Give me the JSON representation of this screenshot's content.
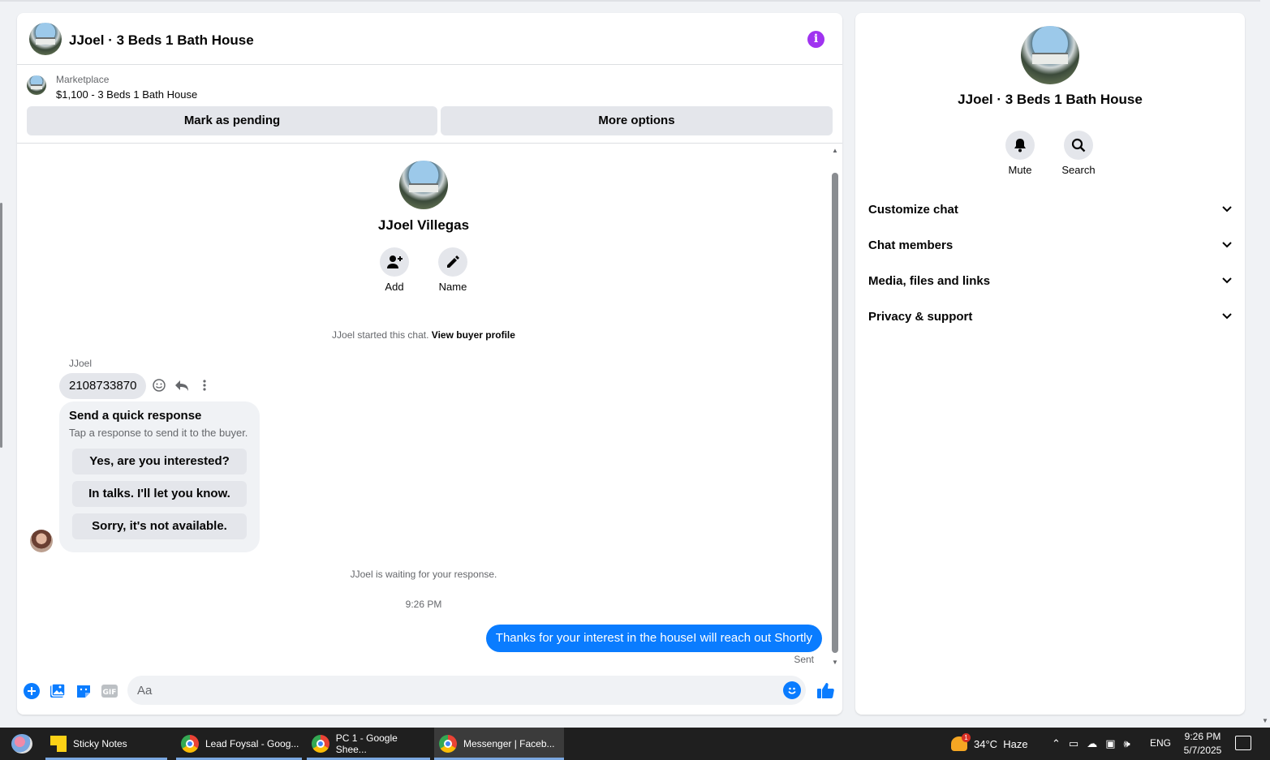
{
  "header": {
    "title": "JJoel · 3 Beds 1 Bath House"
  },
  "listing": {
    "label": "Marketplace",
    "price_title": "$1,100 - 3 Beds 1 Bath House",
    "pending_label": "Mark as pending",
    "more_label": "More options"
  },
  "profile": {
    "name": "JJoel Villegas",
    "add_label": "Add",
    "name_label": "Name"
  },
  "conversation": {
    "started_text": "JJoel started this chat. ",
    "view_profile_label": "View buyer profile",
    "sender_name": "JJoel",
    "incoming_message": "2108733870",
    "quick_response": {
      "title": "Send a quick response",
      "subtitle": "Tap a response to send it to the buyer.",
      "options": [
        "Yes, are you interested?",
        "In talks. I'll let you know.",
        "Sorry, it's not available."
      ]
    },
    "waiting_text": "JJoel is waiting for your response.",
    "timestamp": "9:26 PM",
    "outgoing_message": "Thanks for your interest in the houseI will reach out Shortly",
    "status": "Sent"
  },
  "composer": {
    "placeholder": "Aa"
  },
  "info_panel": {
    "title": "JJoel · 3 Beds 1 Bath House",
    "mute_label": "Mute",
    "search_label": "Search",
    "sections": [
      "Customize chat",
      "Chat members",
      "Media, files and links",
      "Privacy & support"
    ]
  },
  "taskbar": {
    "apps": [
      "Sticky Notes",
      "Lead Foysal - Goog...",
      "PC 1 - Google Shee...",
      "Messenger | Faceb..."
    ],
    "weather": "34°C  Haze",
    "weather_badge": "1",
    "language": "ENG",
    "time": "9:26 PM",
    "date": "5/7/2025"
  },
  "colors": {
    "accent": "#0a7cff",
    "info_icon": "#a033f0",
    "taskbar": "#1f1f1f"
  }
}
